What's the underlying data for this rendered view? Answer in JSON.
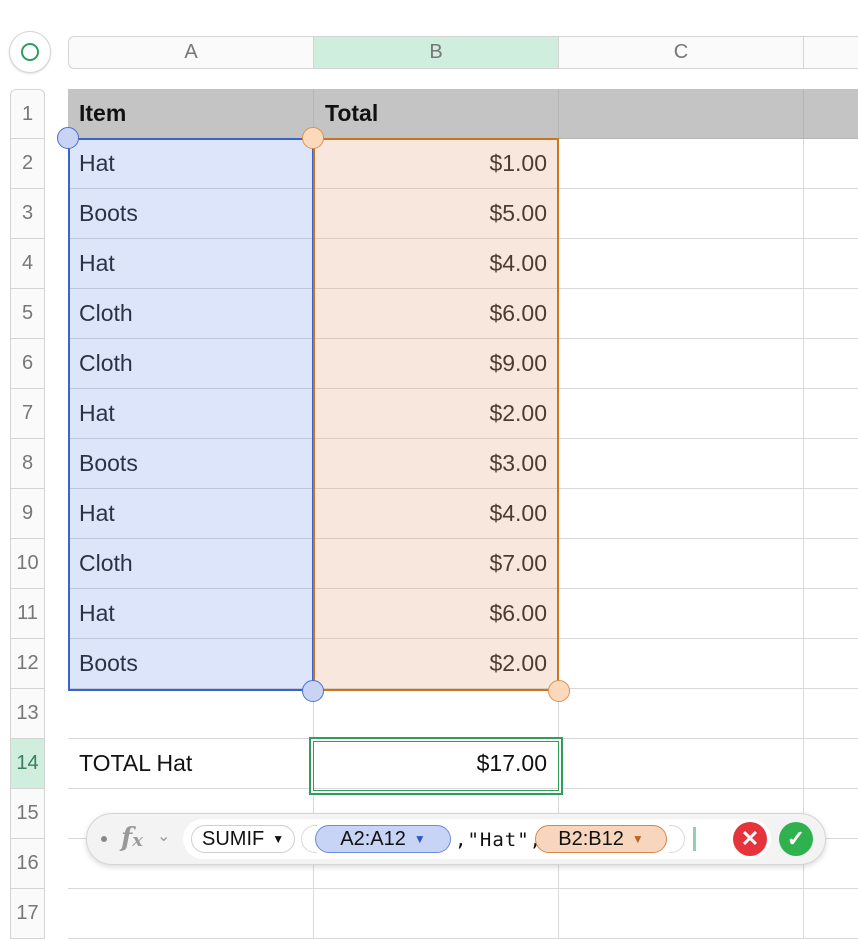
{
  "columns": [
    "A",
    "B",
    "C"
  ],
  "selected_column": "B",
  "rows": [
    "1",
    "2",
    "3",
    "4",
    "5",
    "6",
    "7",
    "8",
    "9",
    "10",
    "11",
    "12",
    "13",
    "14",
    "15",
    "16",
    "17"
  ],
  "selected_row": "14",
  "table": {
    "headers": [
      "Item",
      "Total"
    ],
    "body": [
      [
        "Hat",
        "$1.00"
      ],
      [
        "Boots",
        "$5.00"
      ],
      [
        "Hat",
        "$4.00"
      ],
      [
        "Cloth",
        "$6.00"
      ],
      [
        "Cloth",
        "$9.00"
      ],
      [
        "Hat",
        "$2.00"
      ],
      [
        "Boots",
        "$3.00"
      ],
      [
        "Hat",
        "$4.00"
      ],
      [
        "Cloth",
        "$7.00"
      ],
      [
        "Hat",
        "$6.00"
      ],
      [
        "Boots",
        "$2.00"
      ]
    ],
    "total_label": "TOTAL Hat",
    "total_value": "$17.00"
  },
  "formula_bar": {
    "fx_icon": "fx-icon",
    "function_name": "SUMIF",
    "range_1": "A2:A12",
    "literal": ",\"Hat\",",
    "range_2": "B2:B12",
    "cancel_icon": "cancel-x-icon",
    "accept_icon": "accept-check-icon"
  },
  "colors": {
    "selection_green": "#2f9e5b",
    "range_blue": "#3a64c9",
    "range_orange": "#c77520",
    "header_gray": "#c4c4c4"
  }
}
